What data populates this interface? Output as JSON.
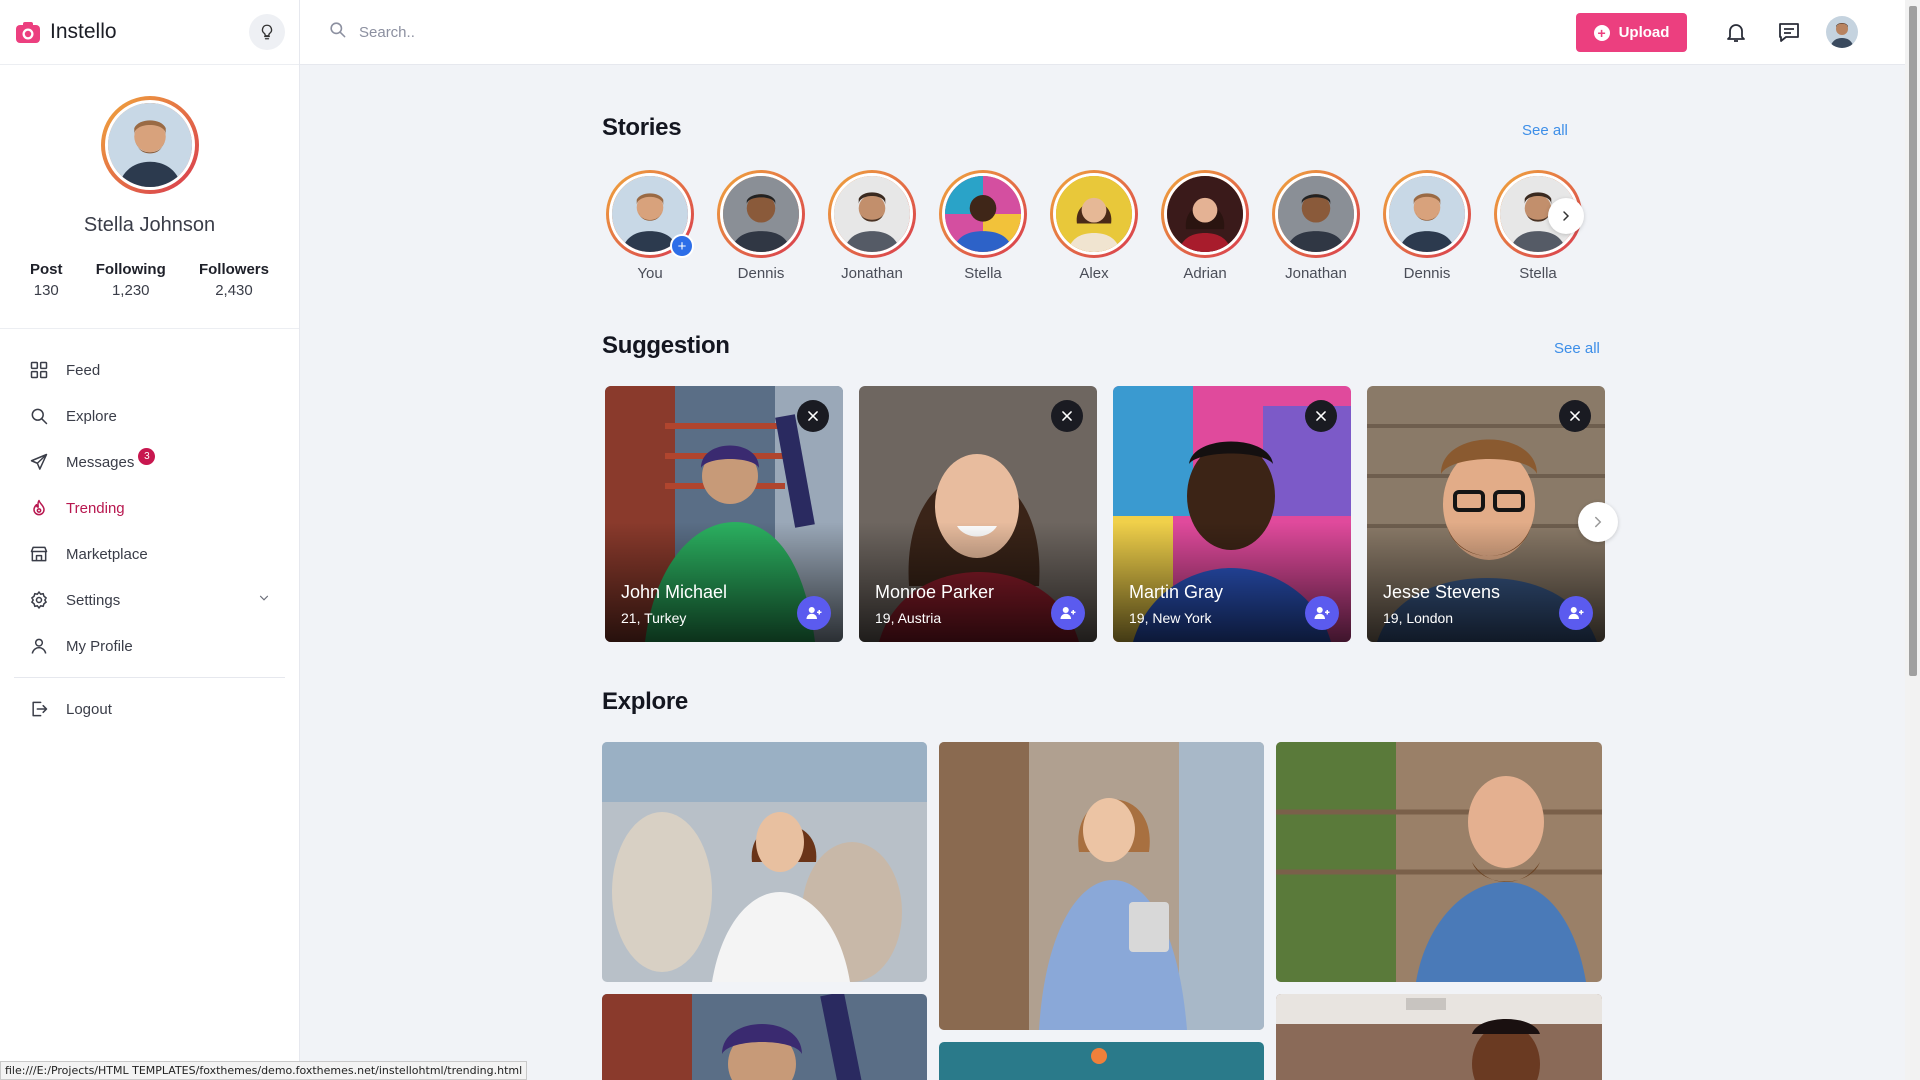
{
  "app": {
    "name": "Instello"
  },
  "profile": {
    "name": "Stella Johnson",
    "stats": [
      {
        "label": "Post",
        "value": "130"
      },
      {
        "label": "Following",
        "value": "1,230"
      },
      {
        "label": "Followers",
        "value": "2,430"
      }
    ]
  },
  "nav": {
    "feed": "Feed",
    "explore": "Explore",
    "messages": "Messages",
    "messages_badge": "3",
    "trending": "Trending",
    "marketplace": "Marketplace",
    "settings": "Settings",
    "my_profile": "My Profile",
    "logout": "Logout",
    "active": "trending"
  },
  "search": {
    "placeholder": "Search.."
  },
  "topbar": {
    "upload_label": "Upload"
  },
  "stories": {
    "title": "Stories",
    "see_all": "See all",
    "items": [
      "You",
      "Dennis",
      "Jonathan",
      "Stella",
      "Alex",
      "Adrian",
      "Jonathan",
      "Dennis",
      "Stella"
    ]
  },
  "suggestion": {
    "title": "Suggestion",
    "see_all": "See all",
    "items": [
      {
        "name": "John Michael",
        "meta": "21, Turkey"
      },
      {
        "name": "Monroe Parker",
        "meta": "19, Austria"
      },
      {
        "name": "Martin Gray",
        "meta": "19, New York"
      },
      {
        "name": "Jesse Stevens",
        "meta": "19, London"
      }
    ]
  },
  "explore": {
    "title": "Explore"
  },
  "status_bar": {
    "url": "file:///E:/Projects/HTML TEMPLATES/foxthemes/demo.foxthemes.net/instellohtml/trending.html"
  },
  "colors": {
    "accent": "#ec3f7f",
    "active_nav": "#b8174f",
    "link": "#3d8ee8",
    "add_button": "#5b5bef"
  }
}
